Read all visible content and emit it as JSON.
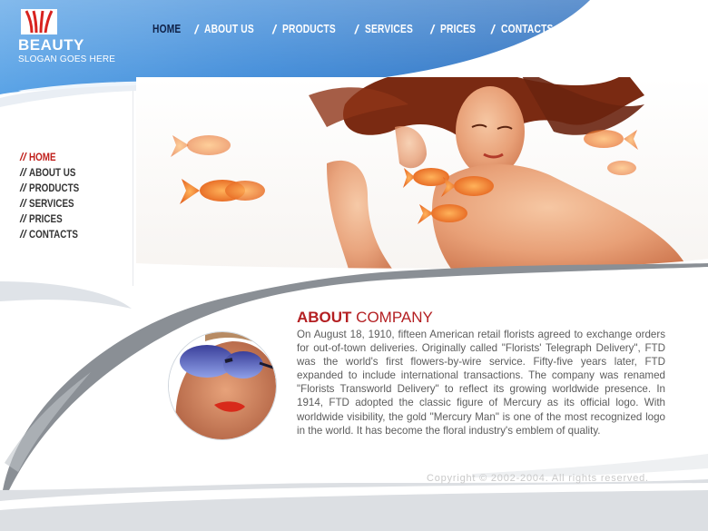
{
  "brand": {
    "name": "BEAUTY",
    "slogan": "SLOGAN GOES HERE",
    "logo_icon": "stylized-flower-logo"
  },
  "top_nav": {
    "items": [
      {
        "label": "HOME",
        "active": true
      },
      {
        "label": "ABOUT US",
        "active": false
      },
      {
        "label": "PRODUCTS",
        "active": false
      },
      {
        "label": "SERVICES",
        "active": false
      },
      {
        "label": "PRICES",
        "active": false
      },
      {
        "label": "CONTACTS",
        "active": false
      }
    ],
    "separator": "/"
  },
  "side_nav": {
    "prefix": "//",
    "items": [
      {
        "label": "HOME",
        "active": true
      },
      {
        "label": "ABOUT US",
        "active": false
      },
      {
        "label": "PRODUCTS",
        "active": false
      },
      {
        "label": "SERVICES",
        "active": false
      },
      {
        "label": "PRICES",
        "active": false
      },
      {
        "label": "CONTACTS",
        "active": false
      }
    ]
  },
  "hero": {
    "image": "woman-underwater-with-goldfish"
  },
  "portrait": {
    "image": "woman-with-sunglasses-portrait"
  },
  "about": {
    "title_bold": "ABOUT",
    "title_rest": " COMPANY",
    "body": "On August 18, 1910, fifteen American retail florists agreed to exchange orders for out-of-town deliveries. Originally called \"Florists' Telegraph Delivery\", FTD was the world's first flowers-by-wire service. Fifty-five years later, FTD expanded to include international transactions. The company was renamed \"Florists Transworld Delivery\" to reflect its growing worldwide presence. In 1914, FTD adopted the classic figure of Mercury as its official logo. With worldwide visibility, the gold \"Mercury Man\" is one of the most recognized logo in the world. It has become the floral industry's emblem of quality."
  },
  "footer": {
    "copyright": "Copyright © 2002-2004. All rights reserved."
  },
  "colors": {
    "header_blue": "#2f7fd0",
    "accent_red": "#c0201c",
    "nav_active_dark": "#0f2147",
    "body_text": "#5c5c5c"
  }
}
